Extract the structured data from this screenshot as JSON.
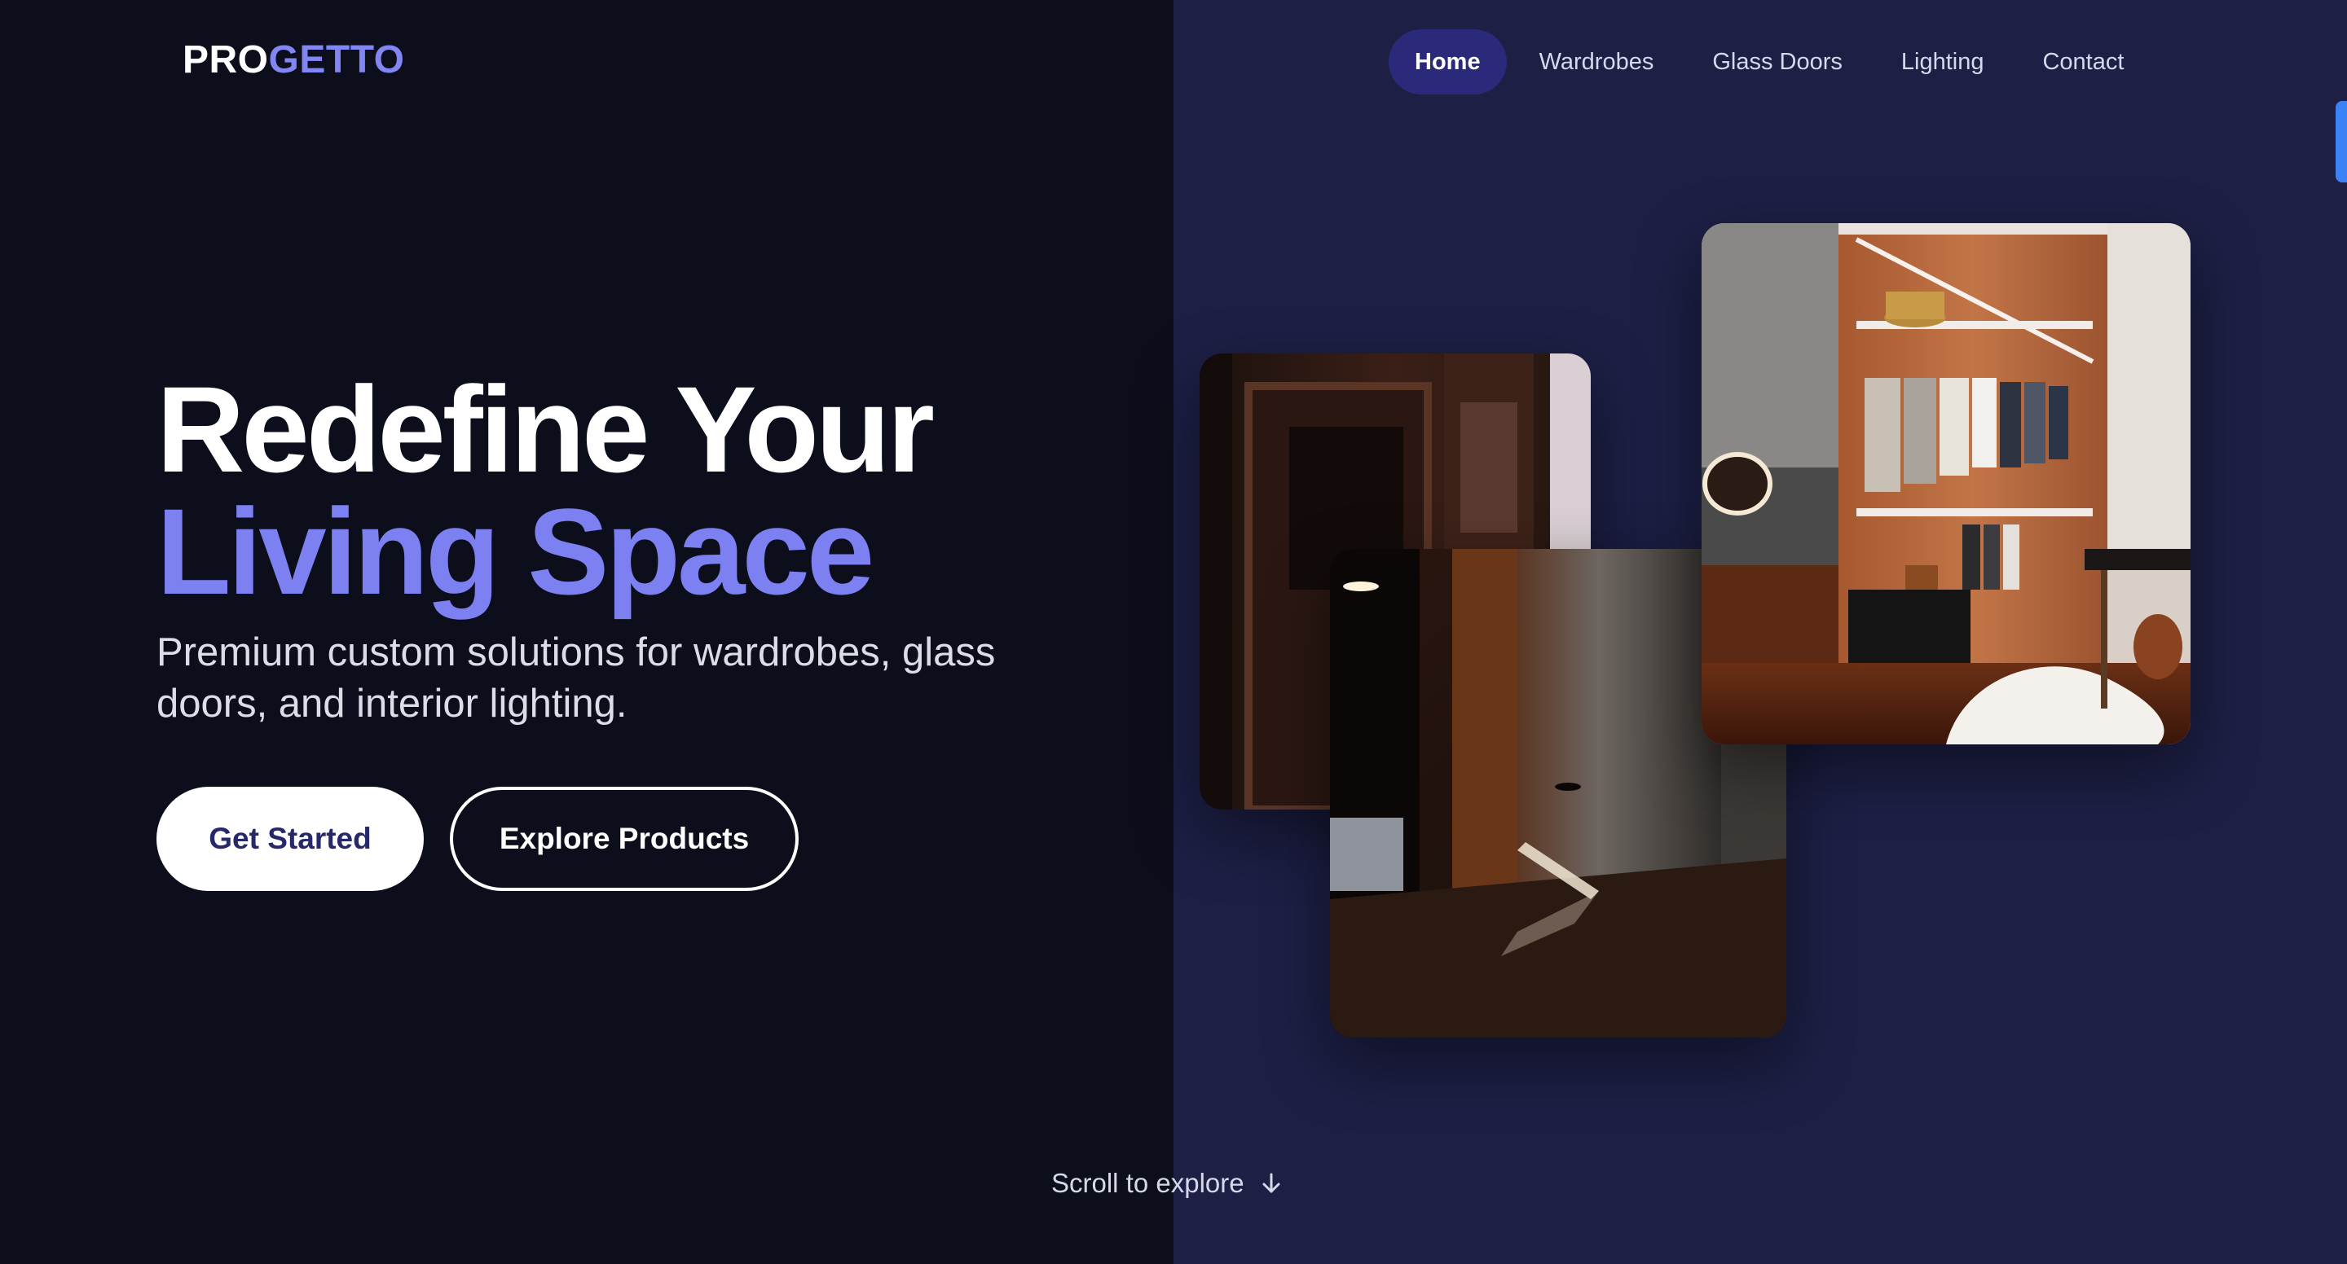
{
  "logo": {
    "part1": "PRO",
    "part2": "GETTO"
  },
  "nav": {
    "items": [
      {
        "label": "Home",
        "active": true
      },
      {
        "label": "Wardrobes",
        "active": false
      },
      {
        "label": "Glass Doors",
        "active": false
      },
      {
        "label": "Lighting",
        "active": false
      },
      {
        "label": "Contact",
        "active": false
      }
    ]
  },
  "hero": {
    "title_line1": "Redefine Your",
    "title_line2": "Living Space",
    "subtitle": "Premium custom solutions for wardrobes, glass doors, and interior lighting.",
    "primary_button": "Get Started",
    "secondary_button": "Explore Products"
  },
  "scroll_hint": {
    "label": "Scroll to explore",
    "icon": "arrow-down-icon"
  },
  "images": [
    {
      "subject": "wooden-glass-door",
      "icon": "door-photo"
    },
    {
      "subject": "curved-lit-hallway",
      "icon": "hallway-photo"
    },
    {
      "subject": "walk-in-wardrobe",
      "icon": "wardrobe-photo"
    }
  ],
  "colors": {
    "background_left": "#0c0f1b",
    "background_right": "#1d1f45",
    "accent": "#7c80f0",
    "nav_active": "#2b2a7a",
    "primary_button_text": "#26286a",
    "edge_tab": "#3b82f6"
  }
}
